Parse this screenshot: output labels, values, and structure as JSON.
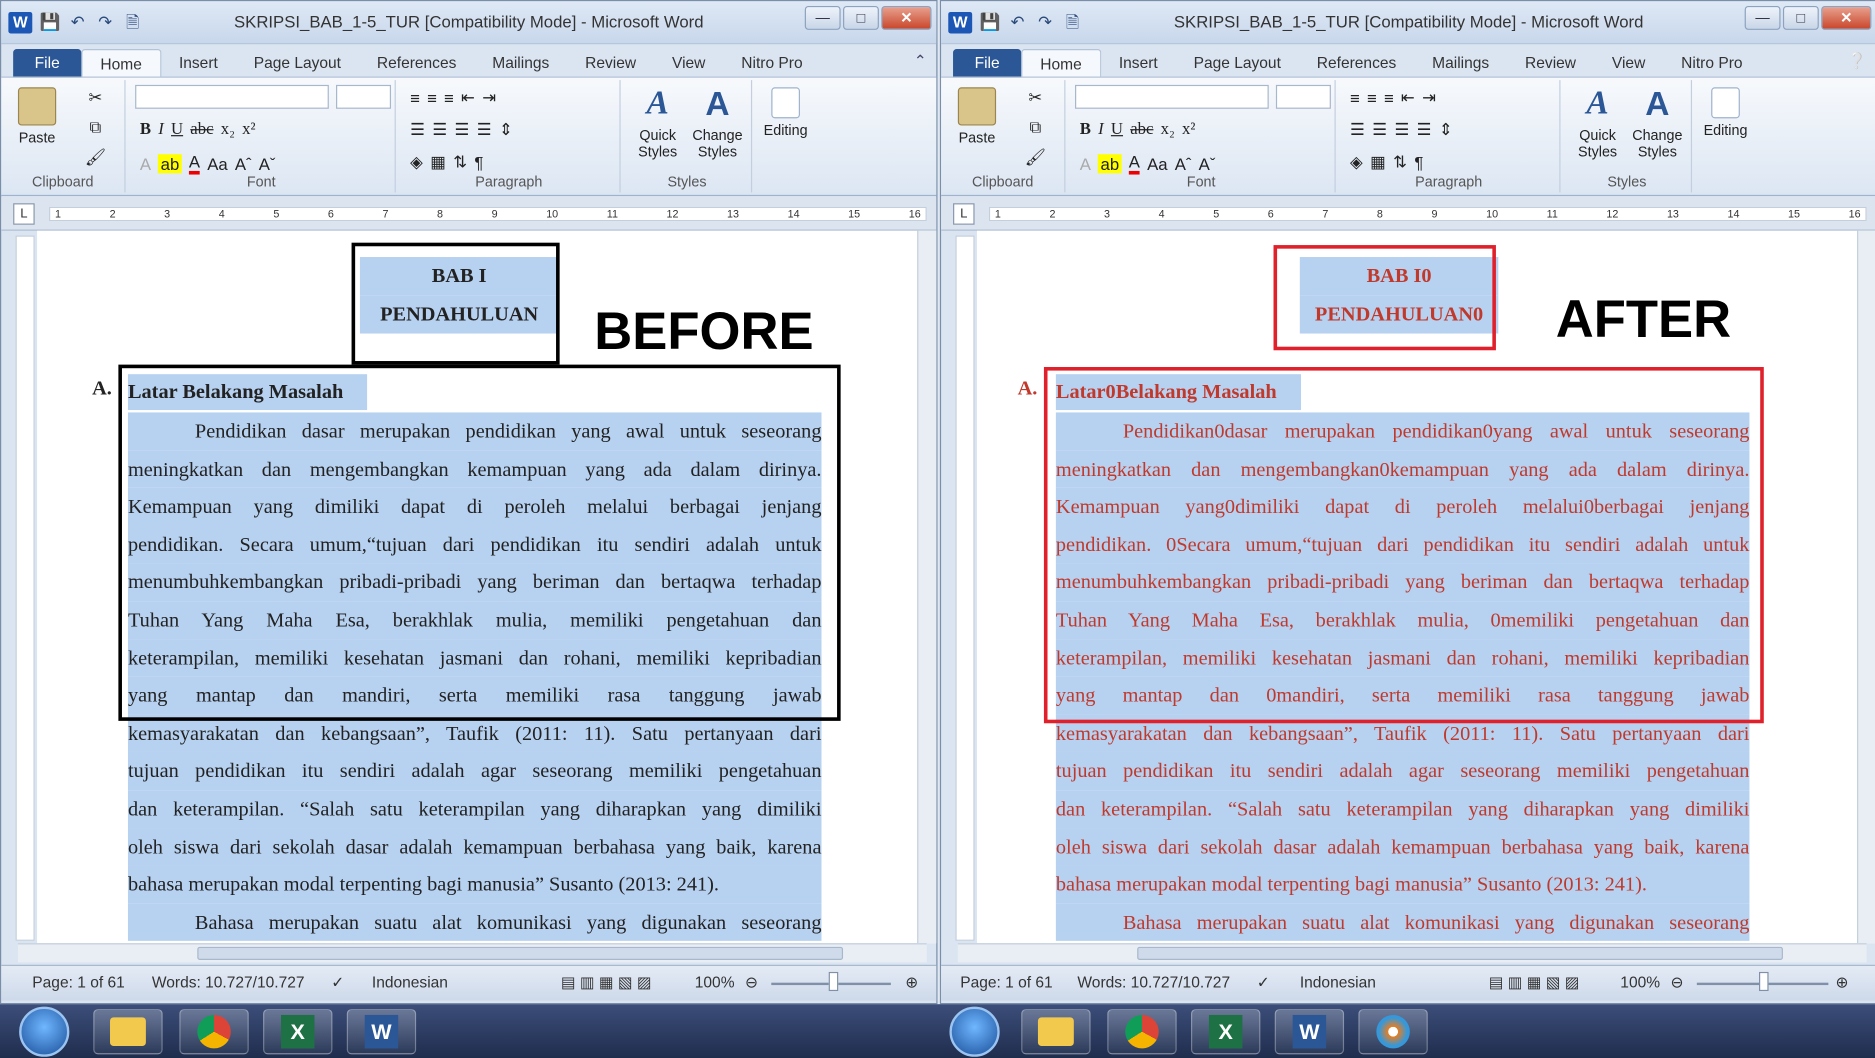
{
  "windows": [
    {
      "side": "left",
      "title": "SKRIPSI_BAB_1-5_TUR [Compatibility Mode]  -  Microsoft Word",
      "tabs": [
        "File",
        "Home",
        "Insert",
        "Page Layout",
        "References",
        "Mailings",
        "Review",
        "View",
        "Nitro Pro"
      ],
      "active_tab": "Home",
      "groups": {
        "clipboard": "Clipboard",
        "font": "Font",
        "paragraph": "Paragraph",
        "styles": "Styles"
      },
      "buttons": {
        "paste": "Paste",
        "quick_styles": "Quick Styles",
        "change_styles": "Change Styles",
        "editing": "Editing"
      },
      "ruler_numbers": [
        "1",
        "2",
        "3",
        "4",
        "5",
        "6",
        "7",
        "8",
        "9",
        "10",
        "11",
        "12",
        "13",
        "14",
        "15",
        "16"
      ],
      "doc": {
        "heading1": "BAB I",
        "heading2": "PENDAHULUAN",
        "sub_letter": "A.",
        "sub_title": "Latar  Belakang Masalah",
        "lines": [
          "Pendidikan  dasar  merupakan  pendidikan  yang  awal  untuk  seseorang",
          "meningkatkan  dan  mengembangkan  kemampuan  yang  ada  dalam  dirinya.",
          "Kemampuan  yang  dimiliki  dapat  di  peroleh  melalui  berbagai  jenjang",
          "pendidikan.  Secara umum,“tujuan dari pendidikan itu sendiri adalah untuk",
          "menumbuhkembangkan pribadi-pribadi yang beriman dan bertaqwa terhadap",
          "Tuhan  Yang  Maha  Esa,  berakhlak  mulia,   memiliki  pengetahuan  dan",
          "keterampilan,  memiliki  kesehatan  jasmani  dan  rohani,  memiliki  kepribadian",
          "yang  mantap  dan   mandiri,  serta  memiliki  rasa  tanggung  jawab",
          "kemasyarakatan dan kebangsaan”, Taufik (2011: 11).  Satu pertanyaan dari",
          "tujuan  pendidikan  itu  sendiri  adalah  agar  seseorang  memiliki  pengetahuan",
          "dan  keterampilan.  “Salah  satu  keterampilan  yang  diharapkan  yang  dimiliki",
          "oleh  siswa  dari  sekolah  dasar  adalah  kemampuan  berbahasa  yang  baik,  karena",
          "bahasa merupakan modal terpenting bagi manusia” Susanto (2013: 241).",
          "Bahasa  merupakan  suatu  alat  komunikasi  yang  digunakan  seseorang"
        ]
      },
      "label": "BEFORE",
      "label_color": "#000000",
      "status": {
        "page": "Page: 1 of 61",
        "words": "Words: 10.727/10.727",
        "language": "Indonesian",
        "zoom": "100%"
      }
    },
    {
      "side": "right",
      "title": "SKRIPSI_BAB_1-5_TUR [Compatibility Mode]  -  Microsoft Word",
      "tabs": [
        "File",
        "Home",
        "Insert",
        "Page Layout",
        "References",
        "Mailings",
        "Review",
        "View",
        "Nitro Pro"
      ],
      "active_tab": "Home",
      "groups": {
        "clipboard": "Clipboard",
        "font": "Font",
        "paragraph": "Paragraph",
        "styles": "Styles"
      },
      "buttons": {
        "paste": "Paste",
        "quick_styles": "Quick Styles",
        "change_styles": "Change Styles",
        "editing": "Editing"
      },
      "ruler_numbers": [
        "1",
        "2",
        "3",
        "4",
        "5",
        "6",
        "7",
        "8",
        "9",
        "10",
        "11",
        "12",
        "13",
        "14",
        "15",
        "16"
      ],
      "doc": {
        "heading1": "BAB I0",
        "heading2": "PENDAHULUAN0",
        "sub_letter": "A.",
        "sub_title": "Latar0Belakang Masalah",
        "lines": [
          "Pendidikan0dasar  merupakan  pendidikan0yang  awal  untuk  seseorang",
          "meningkatkan  dan  mengembangkan0kemampuan  yang  ada  dalam  dirinya.",
          "Kemampuan  yang0dimiliki  dapat  di  peroleh  melalui0berbagai  jenjang",
          "pendidikan.  0Secara  umum,“tujuan  dari  pendidikan  itu  sendiri  adalah  untuk",
          "menumbuhkembangkan  pribadi-pribadi  yang  beriman  dan  bertaqwa  terhadap",
          "Tuhan  Yang  Maha  Esa,  berakhlak  mulia,  0memiliki  pengetahuan  dan",
          "keterampilan,  memiliki  kesehatan  jasmani  dan  rohani,  memiliki  kepribadian",
          "yang  mantap  dan  0mandiri,  serta  memiliki  rasa  tanggung  jawab",
          "kemasyarakatan  dan  kebangsaan”,  Taufik  (2011:  11).   Satu  pertanyaan  dari",
          "tujuan  pendidikan  itu  sendiri  adalah  agar  seseorang  memiliki  pengetahuan",
          "dan  keterampilan.  “Salah  satu  keterampilan  yang  diharapkan  yang  dimiliki",
          "oleh  siswa  dari  sekolah  dasar  adalah  kemampuan  berbahasa  yang  baik,  karena",
          "bahasa merupakan modal terpenting bagi manusia”  Susanto (2013: 241).",
          "Bahasa  merupakan  suatu  alat  komunikasi  yang  digunakan  seseorang"
        ]
      },
      "label": "AFTER",
      "label_color": "#e0202a",
      "status": {
        "page": "Page: 1 of 61",
        "words": "Words: 10.727/10.727",
        "language": "Indonesian",
        "zoom": "100%"
      }
    }
  ],
  "taskbar": {
    "items": [
      "start-orb",
      "explorer-icon",
      "chrome-icon",
      "excel-icon",
      "word-icon"
    ]
  }
}
